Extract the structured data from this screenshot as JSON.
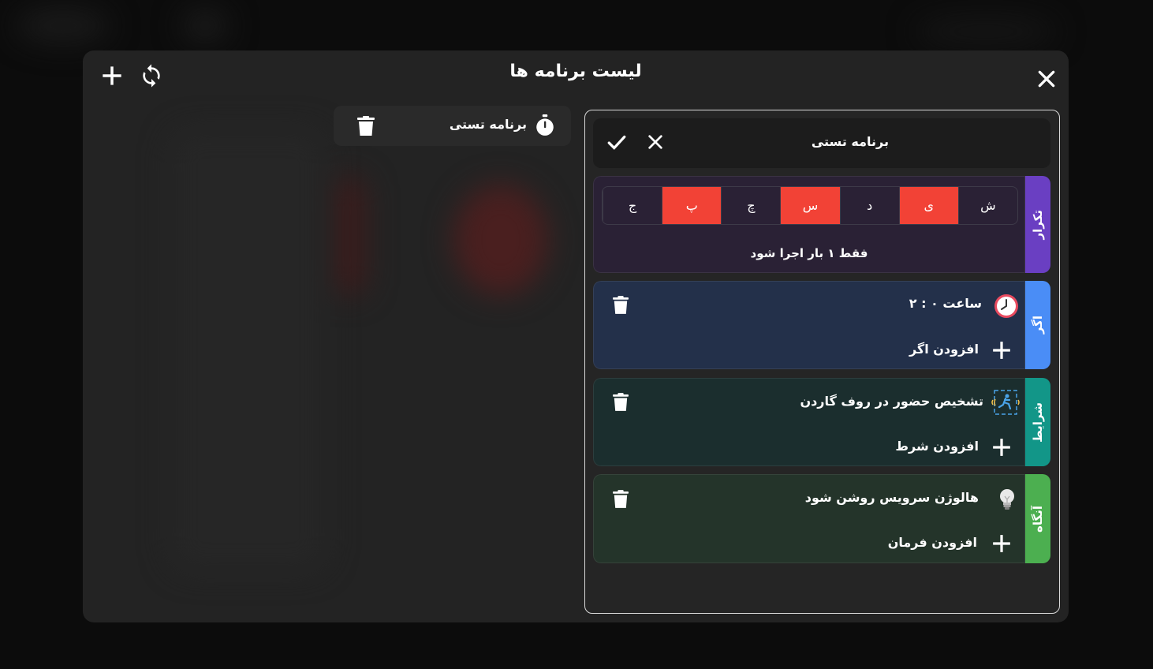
{
  "modal": {
    "title": "لیست برنامه ها"
  },
  "program_list": [
    {
      "name": "برنامه تستی"
    }
  ],
  "editor": {
    "program_name": "برنامه تستی",
    "repeat": {
      "tab_label": "تکرار",
      "days": [
        {
          "label": "ش",
          "active": false
        },
        {
          "label": "ی",
          "active": true
        },
        {
          "label": "د",
          "active": false
        },
        {
          "label": "س",
          "active": true
        },
        {
          "label": "چ",
          "active": false
        },
        {
          "label": "پ",
          "active": true
        },
        {
          "label": "ج",
          "active": false
        }
      ],
      "summary": "فقط ۱ بار اجرا شود",
      "color": "#6a3fc2",
      "body_color": "#2a2135"
    },
    "if": {
      "tab_label": "اگر",
      "item_text": "ساعت ۰ : ۲",
      "item_icon": "clock-icon",
      "add_label": "افزودن اگر",
      "color": "#4a8df6",
      "body_color": "#23304a"
    },
    "conditions": {
      "tab_label": "شرایط",
      "item_text": "تشخیص حضور در روف گاردن",
      "item_icon": "motion-sensor-icon",
      "add_label": "افزودن شرط",
      "color": "#129688",
      "body_color": "#1b2e2e"
    },
    "then": {
      "tab_label": "آنگاه",
      "item_text": "هالوژن سرویس روشن شود",
      "item_icon": "lightbulb-icon",
      "add_label": "افزودن فرمان",
      "color": "#4caf50",
      "body_color": "#24342a"
    }
  }
}
